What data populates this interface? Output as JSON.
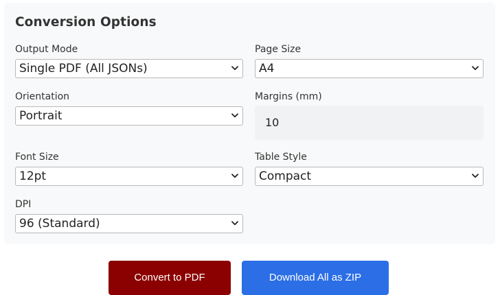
{
  "section": {
    "title": "Conversion Options"
  },
  "fields": {
    "output_mode": {
      "label": "Output Mode",
      "value": "Single PDF (All JSONs)"
    },
    "page_size": {
      "label": "Page Size",
      "value": "A4"
    },
    "orientation": {
      "label": "Orientation",
      "value": "Portrait"
    },
    "margins": {
      "label": "Margins (mm)",
      "value": "10"
    },
    "font_size": {
      "label": "Font Size",
      "value": "12pt"
    },
    "table_style": {
      "label": "Table Style",
      "value": "Compact"
    },
    "dpi": {
      "label": "DPI",
      "value": "96 (Standard)"
    }
  },
  "actions": {
    "convert_label": "Convert to PDF",
    "download_zip_label": "Download All as ZIP"
  },
  "colors": {
    "convert_button": "#8b0000",
    "download_button": "#2b6ee6",
    "panel_background": "#f8f9fa"
  },
  "icons": {
    "select_indicator": "chevron-down-icon"
  }
}
